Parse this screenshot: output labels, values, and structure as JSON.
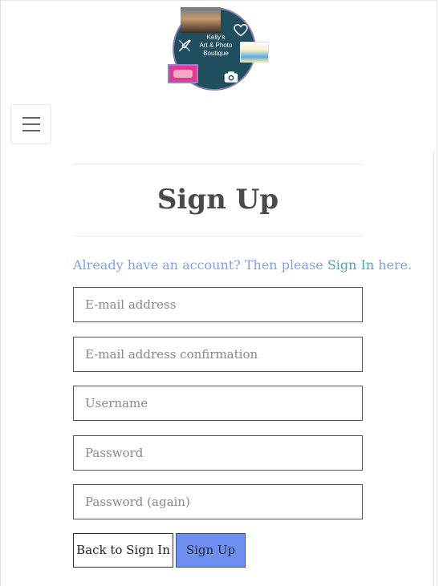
{
  "logo": {
    "text_line1": "Kelly's",
    "text_line2": "Art & Photo",
    "text_line3": "Boutique"
  },
  "nav": {
    "menu_icon": "hamburger-icon"
  },
  "form": {
    "title": "Sign Up",
    "signin_prefix": "Already have an account? Then please ",
    "signin_link": "Sign In",
    "signin_suffix": " here.",
    "fields": {
      "email_placeholder": "E-mail address",
      "email_confirm_placeholder": "E-mail address confirmation",
      "username_placeholder": "Username",
      "password_placeholder": "Password",
      "password_again_placeholder": "Password (again)"
    },
    "back_label": "Back to Sign In",
    "submit_label": "Sign Up"
  },
  "colors": {
    "accent_button": "#6f8ff0",
    "link": "#4f9fb6",
    "muted_link_text": "#7fa2e6"
  }
}
